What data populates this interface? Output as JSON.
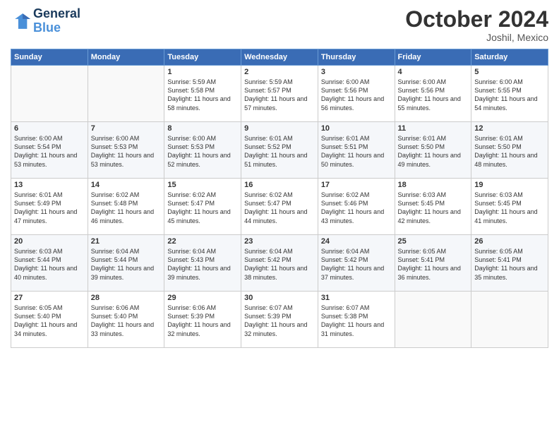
{
  "header": {
    "logo_line1": "General",
    "logo_line2": "Blue",
    "month_title": "October 2024",
    "location": "Joshil, Mexico"
  },
  "weekdays": [
    "Sunday",
    "Monday",
    "Tuesday",
    "Wednesday",
    "Thursday",
    "Friday",
    "Saturday"
  ],
  "weeks": [
    [
      {
        "day": "",
        "info": ""
      },
      {
        "day": "",
        "info": ""
      },
      {
        "day": "1",
        "info": "Sunrise: 5:59 AM\nSunset: 5:58 PM\nDaylight: 11 hours and 58 minutes."
      },
      {
        "day": "2",
        "info": "Sunrise: 5:59 AM\nSunset: 5:57 PM\nDaylight: 11 hours and 57 minutes."
      },
      {
        "day": "3",
        "info": "Sunrise: 6:00 AM\nSunset: 5:56 PM\nDaylight: 11 hours and 56 minutes."
      },
      {
        "day": "4",
        "info": "Sunrise: 6:00 AM\nSunset: 5:56 PM\nDaylight: 11 hours and 55 minutes."
      },
      {
        "day": "5",
        "info": "Sunrise: 6:00 AM\nSunset: 5:55 PM\nDaylight: 11 hours and 54 minutes."
      }
    ],
    [
      {
        "day": "6",
        "info": "Sunrise: 6:00 AM\nSunset: 5:54 PM\nDaylight: 11 hours and 53 minutes."
      },
      {
        "day": "7",
        "info": "Sunrise: 6:00 AM\nSunset: 5:53 PM\nDaylight: 11 hours and 53 minutes."
      },
      {
        "day": "8",
        "info": "Sunrise: 6:00 AM\nSunset: 5:53 PM\nDaylight: 11 hours and 52 minutes."
      },
      {
        "day": "9",
        "info": "Sunrise: 6:01 AM\nSunset: 5:52 PM\nDaylight: 11 hours and 51 minutes."
      },
      {
        "day": "10",
        "info": "Sunrise: 6:01 AM\nSunset: 5:51 PM\nDaylight: 11 hours and 50 minutes."
      },
      {
        "day": "11",
        "info": "Sunrise: 6:01 AM\nSunset: 5:50 PM\nDaylight: 11 hours and 49 minutes."
      },
      {
        "day": "12",
        "info": "Sunrise: 6:01 AM\nSunset: 5:50 PM\nDaylight: 11 hours and 48 minutes."
      }
    ],
    [
      {
        "day": "13",
        "info": "Sunrise: 6:01 AM\nSunset: 5:49 PM\nDaylight: 11 hours and 47 minutes."
      },
      {
        "day": "14",
        "info": "Sunrise: 6:02 AM\nSunset: 5:48 PM\nDaylight: 11 hours and 46 minutes."
      },
      {
        "day": "15",
        "info": "Sunrise: 6:02 AM\nSunset: 5:47 PM\nDaylight: 11 hours and 45 minutes."
      },
      {
        "day": "16",
        "info": "Sunrise: 6:02 AM\nSunset: 5:47 PM\nDaylight: 11 hours and 44 minutes."
      },
      {
        "day": "17",
        "info": "Sunrise: 6:02 AM\nSunset: 5:46 PM\nDaylight: 11 hours and 43 minutes."
      },
      {
        "day": "18",
        "info": "Sunrise: 6:03 AM\nSunset: 5:45 PM\nDaylight: 11 hours and 42 minutes."
      },
      {
        "day": "19",
        "info": "Sunrise: 6:03 AM\nSunset: 5:45 PM\nDaylight: 11 hours and 41 minutes."
      }
    ],
    [
      {
        "day": "20",
        "info": "Sunrise: 6:03 AM\nSunset: 5:44 PM\nDaylight: 11 hours and 40 minutes."
      },
      {
        "day": "21",
        "info": "Sunrise: 6:04 AM\nSunset: 5:44 PM\nDaylight: 11 hours and 39 minutes."
      },
      {
        "day": "22",
        "info": "Sunrise: 6:04 AM\nSunset: 5:43 PM\nDaylight: 11 hours and 39 minutes."
      },
      {
        "day": "23",
        "info": "Sunrise: 6:04 AM\nSunset: 5:42 PM\nDaylight: 11 hours and 38 minutes."
      },
      {
        "day": "24",
        "info": "Sunrise: 6:04 AM\nSunset: 5:42 PM\nDaylight: 11 hours and 37 minutes."
      },
      {
        "day": "25",
        "info": "Sunrise: 6:05 AM\nSunset: 5:41 PM\nDaylight: 11 hours and 36 minutes."
      },
      {
        "day": "26",
        "info": "Sunrise: 6:05 AM\nSunset: 5:41 PM\nDaylight: 11 hours and 35 minutes."
      }
    ],
    [
      {
        "day": "27",
        "info": "Sunrise: 6:05 AM\nSunset: 5:40 PM\nDaylight: 11 hours and 34 minutes."
      },
      {
        "day": "28",
        "info": "Sunrise: 6:06 AM\nSunset: 5:40 PM\nDaylight: 11 hours and 33 minutes."
      },
      {
        "day": "29",
        "info": "Sunrise: 6:06 AM\nSunset: 5:39 PM\nDaylight: 11 hours and 32 minutes."
      },
      {
        "day": "30",
        "info": "Sunrise: 6:07 AM\nSunset: 5:39 PM\nDaylight: 11 hours and 32 minutes."
      },
      {
        "day": "31",
        "info": "Sunrise: 6:07 AM\nSunset: 5:38 PM\nDaylight: 11 hours and 31 minutes."
      },
      {
        "day": "",
        "info": ""
      },
      {
        "day": "",
        "info": ""
      }
    ]
  ]
}
